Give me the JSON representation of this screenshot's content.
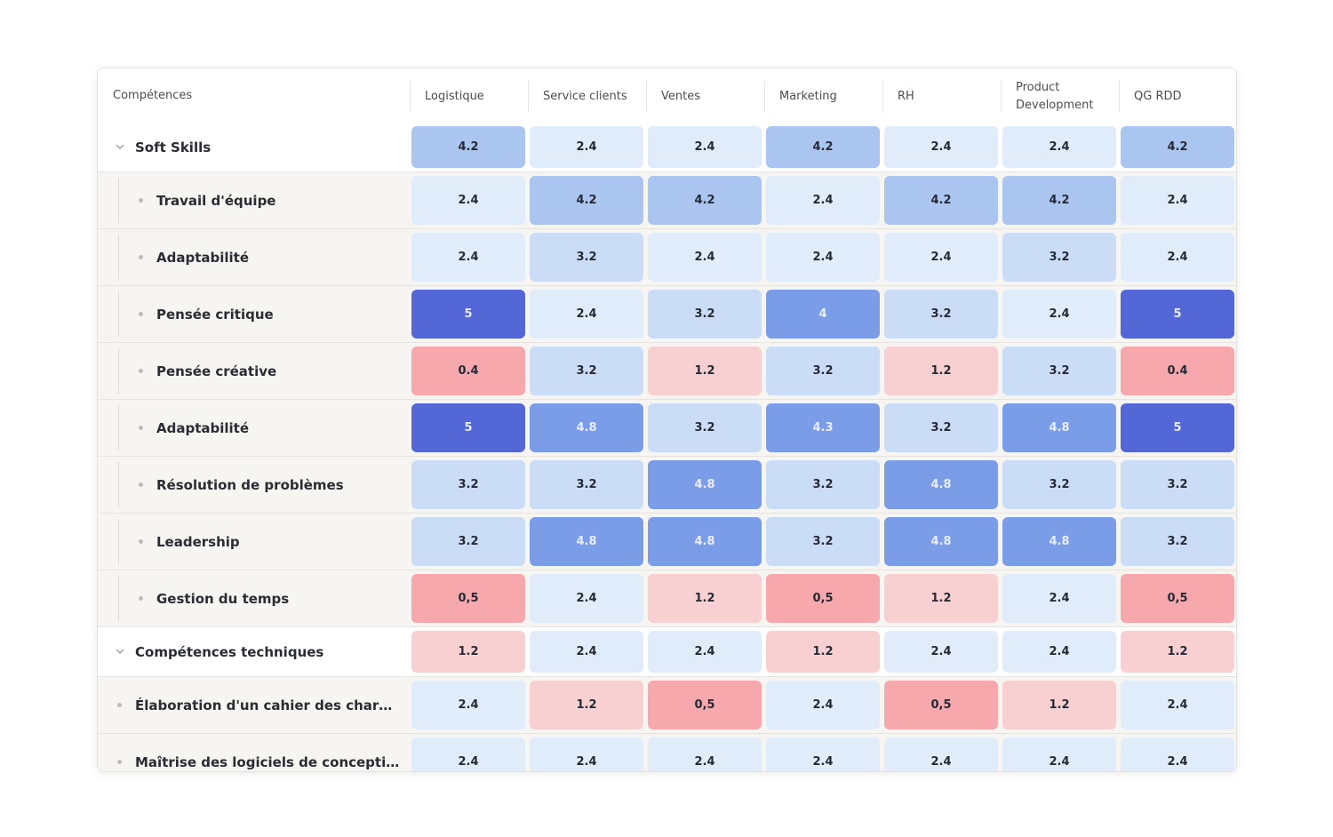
{
  "table": {
    "header": {
      "competences_label": "Compétences",
      "departments": [
        "Logistique",
        "Service clients",
        "Ventes",
        "Marketing",
        "RH",
        "Product Development",
        "QG RDD"
      ]
    },
    "rows": [
      {
        "type": "group",
        "label": "Soft Skills",
        "expanded": true,
        "values": [
          "4.2",
          "2.4",
          "2.4",
          "4.2",
          "2.4",
          "2.4",
          "4.2"
        ]
      },
      {
        "type": "child",
        "nested": true,
        "label": "Travail d'équipe",
        "values": [
          "2.4",
          "4.2",
          "4.2",
          "2.4",
          "4.2",
          "4.2",
          "2.4"
        ]
      },
      {
        "type": "child",
        "nested": true,
        "label": "Adaptabilité",
        "values": [
          "2.4",
          "3.2",
          "2.4",
          "2.4",
          "2.4",
          "3.2",
          "2.4"
        ]
      },
      {
        "type": "child",
        "nested": true,
        "label": "Pensée critique",
        "values": [
          "5",
          "2.4",
          "3.2",
          "4",
          "3.2",
          "2.4",
          "5"
        ]
      },
      {
        "type": "child",
        "nested": true,
        "label": "Pensée créative",
        "values": [
          "0.4",
          "3.2",
          "1.2",
          "3.2",
          "1.2",
          "3.2",
          "0.4"
        ]
      },
      {
        "type": "child",
        "nested": true,
        "label": "Adaptabilité",
        "values": [
          "5",
          "4.8",
          "3.2",
          "4.3",
          "3.2",
          "4.8",
          "5"
        ]
      },
      {
        "type": "child",
        "nested": true,
        "label": "Résolution de problèmes",
        "values": [
          "3.2",
          "3.2",
          "4.8",
          "3.2",
          "4.8",
          "3.2",
          "3.2"
        ]
      },
      {
        "type": "child",
        "nested": true,
        "label": "Leadership",
        "values": [
          "3.2",
          "4.8",
          "4.8",
          "3.2",
          "4.8",
          "4.8",
          "3.2"
        ]
      },
      {
        "type": "child",
        "nested": true,
        "label": "Gestion du temps",
        "values": [
          "0,5",
          "2.4",
          "1.2",
          "0,5",
          "1.2",
          "2.4",
          "0,5"
        ]
      },
      {
        "type": "group",
        "label": "Compétences techniques",
        "expanded": true,
        "values": [
          "1.2",
          "2.4",
          "2.4",
          "1.2",
          "2.4",
          "2.4",
          "1.2"
        ]
      },
      {
        "type": "child",
        "nested": false,
        "label": "Élaboration d'un cahier des charges c...",
        "values": [
          "2.4",
          "1.2",
          "0,5",
          "2.4",
          "0,5",
          "1.2",
          "2.4"
        ]
      },
      {
        "type": "child",
        "nested": false,
        "label": "Maîtrise des logiciels de conception g...",
        "values": [
          "2.4",
          "2.4",
          "2.4",
          "2.4",
          "2.4",
          "2.4",
          "2.4"
        ]
      }
    ]
  },
  "color_scale": {
    "0.4": "#f6a8ac",
    "0.5": "#f6a8ac",
    "1.2": "#f9d0d2",
    "2.4": "#e1ecfb",
    "3.2": "#cbdcf6",
    "4": "#7b9ce6",
    "4.2": "#abc5f1",
    "4.3": "#7b9ce6",
    "4.8": "#7b9ce6",
    "5": "#5367d6"
  },
  "dark_text_threshold": 4.0
}
